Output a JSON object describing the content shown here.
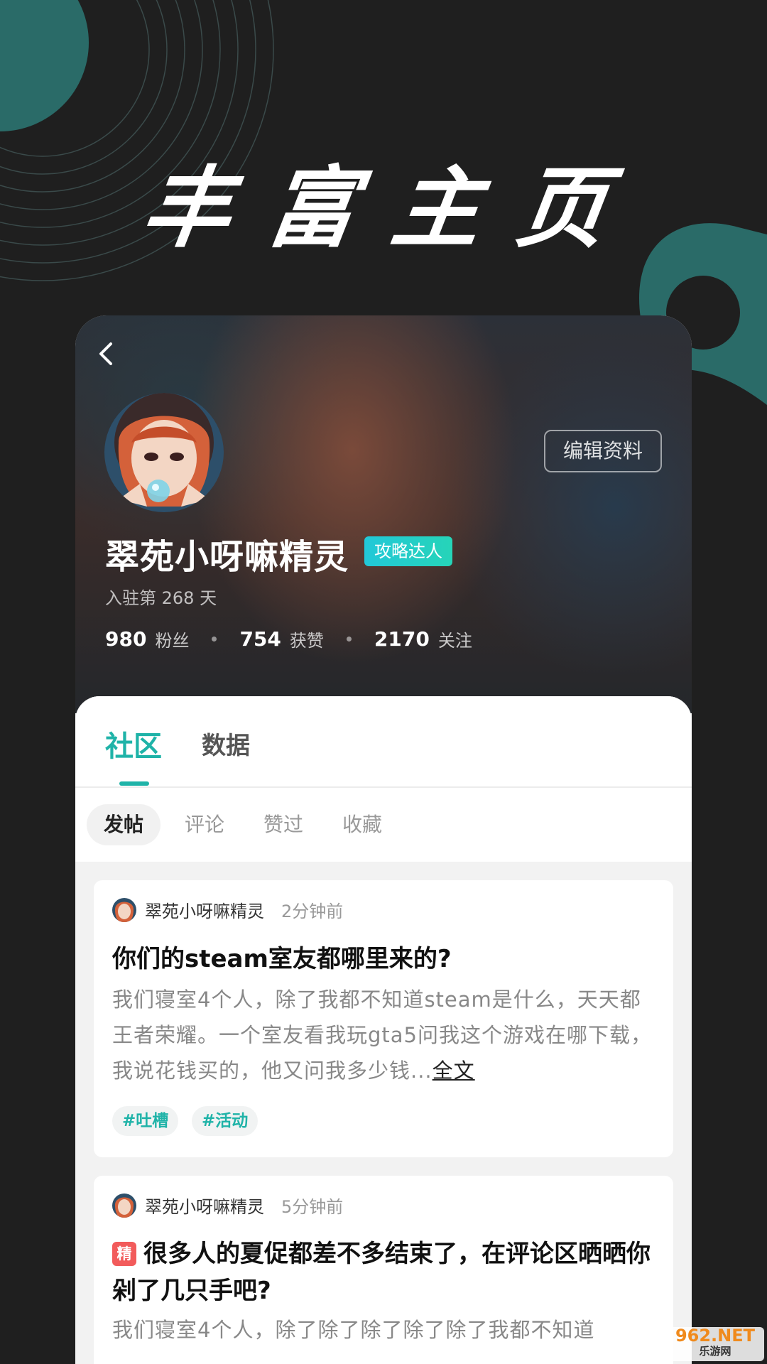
{
  "hero": {
    "title": "丰富主页"
  },
  "profile": {
    "back_icon": "chevron-left-icon",
    "edit_label": "编辑资料",
    "username": "翠苑小呀嘛精灵",
    "badge": "攻略达人",
    "join_text": "入驻第 268 天",
    "stats": [
      {
        "value": "980",
        "label": "粉丝"
      },
      {
        "value": "754",
        "label": "获赞"
      },
      {
        "value": "2170",
        "label": "关注"
      }
    ]
  },
  "tabs": {
    "community": "社区",
    "data": "数据"
  },
  "subtabs": [
    "发帖",
    "评论",
    "赞过",
    "收藏"
  ],
  "posts": [
    {
      "author": "翠苑小呀嘛精灵",
      "time": "2分钟前",
      "title": "你们的steam室友都哪里来的?",
      "body": "我们寝室4个人，除了我都不知道steam是什么，天天都王者荣耀。一个室友看我玩gta5问我这个游戏在哪下载，我说花钱买的，他又问我多少钱...",
      "fulltext": "全文",
      "tags": [
        "#吐槽",
        "#活动"
      ]
    },
    {
      "author": "翠苑小呀嘛精灵",
      "time": "5分钟前",
      "featured_label": "精",
      "title": "很多人的夏促都差不多结束了，在评论区晒晒你剁了几只手吧?",
      "body": "我们寝室4个人，除了除了除了除了除了我都不知道"
    }
  ],
  "watermark": {
    "main": "962.NET",
    "sub": "乐游网"
  },
  "colors": {
    "accent": "#1fb3a8",
    "badge": "#22c8d8",
    "featured": "#f25b5b",
    "background": "#1f1f1f",
    "deco_teal": "#2a6b68"
  }
}
